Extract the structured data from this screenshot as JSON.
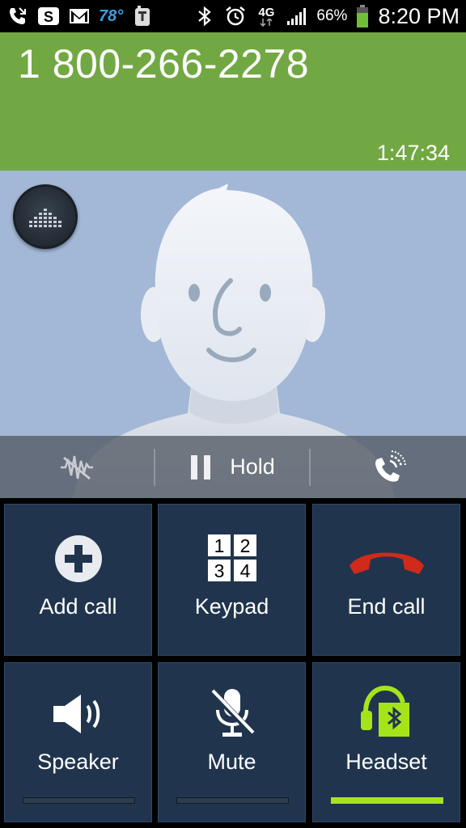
{
  "status_bar": {
    "temperature": "78°",
    "battery_percent": "66%",
    "time": "8:20 PM",
    "network": "4G",
    "icons": [
      "missed-call-icon",
      "s-app-icon",
      "gmail-icon",
      "weather-temperature",
      "tmobile-icon",
      "bluetooth-icon",
      "alarm-icon",
      "4g-icon",
      "signal-icon",
      "battery-icon"
    ]
  },
  "call": {
    "number": "1 800-266-2278",
    "duration": "1:47:34"
  },
  "hold_bar": {
    "hold_label": "Hold",
    "left_icon": "noise-reduction-icon",
    "right_icon": "call-quality-icon"
  },
  "actions": {
    "add_call": "Add call",
    "keypad": "Keypad",
    "end_call": "End call",
    "speaker": "Speaker",
    "mute": "Mute",
    "headset": "Headset",
    "keypad_digits": [
      "1",
      "2",
      "3",
      "4"
    ],
    "headset_active": true
  },
  "colors": {
    "header_green": "#72a843",
    "avatar_bg": "#a2b8d6",
    "tile_bg": "#20354d",
    "end_call_red": "#d02a1a",
    "headset_green": "#a6e41a"
  }
}
